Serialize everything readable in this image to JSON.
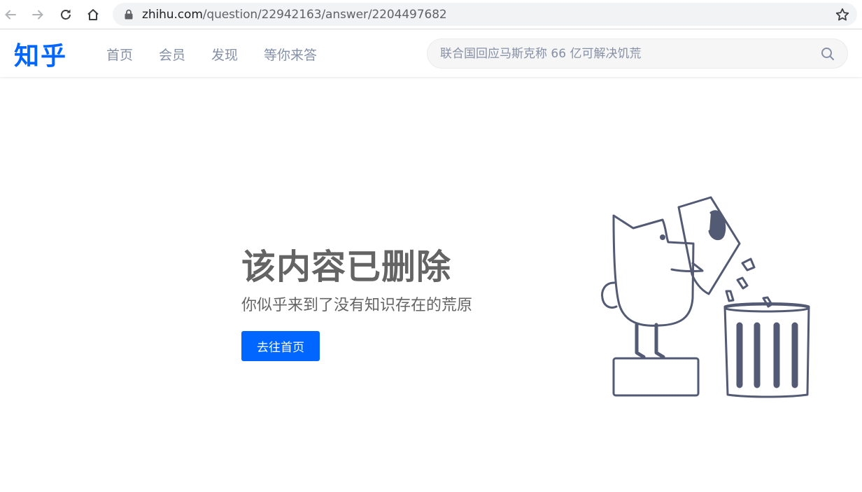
{
  "browser": {
    "url_host": "zhihu.com",
    "url_path": "/question/22942163/answer/2204497682"
  },
  "header": {
    "logo": "知乎",
    "nav": [
      {
        "label": "首页"
      },
      {
        "label": "会员"
      },
      {
        "label": "发现"
      },
      {
        "label": "等你来答"
      }
    ],
    "search_placeholder": "联合国回应马斯克称 66 亿可解决饥荒"
  },
  "main": {
    "title": "该内容已删除",
    "subtitle": "你似乎来到了没有知识存在的荒原",
    "home_button": "去往首页"
  },
  "colors": {
    "brand": "#0066ff",
    "text_gray": "#646464",
    "nav_gray": "#8590a6",
    "illustration_stroke": "#535a74"
  },
  "icons": {
    "back": "arrow-left-icon",
    "forward": "arrow-right-icon",
    "reload": "reload-icon",
    "home": "home-icon",
    "lock": "lock-icon",
    "bookmark": "star-icon",
    "search": "search-icon"
  }
}
